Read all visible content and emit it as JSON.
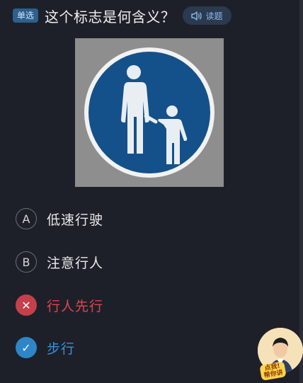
{
  "header": {
    "type_badge": "单选",
    "question": "这个标志是何含义？",
    "read_button_label": "读题"
  },
  "sign": {
    "icon": "pedestrian-walk-sign-icon",
    "bg_color": "#14518a"
  },
  "options": [
    {
      "marker": "A",
      "text": "低速行驶",
      "state": "normal"
    },
    {
      "marker": "B",
      "text": "注意行人",
      "state": "normal"
    },
    {
      "marker": "✕",
      "text": "行人先行",
      "state": "wrong"
    },
    {
      "marker": "✓",
      "text": "步行",
      "state": "correct"
    }
  ],
  "helper": {
    "label": "点我!\n帮你讲",
    "icon": "teacher-avatar-icon"
  },
  "colors": {
    "background": "#1e2029",
    "accent": "#2e86c8",
    "wrong": "#c5404a"
  }
}
